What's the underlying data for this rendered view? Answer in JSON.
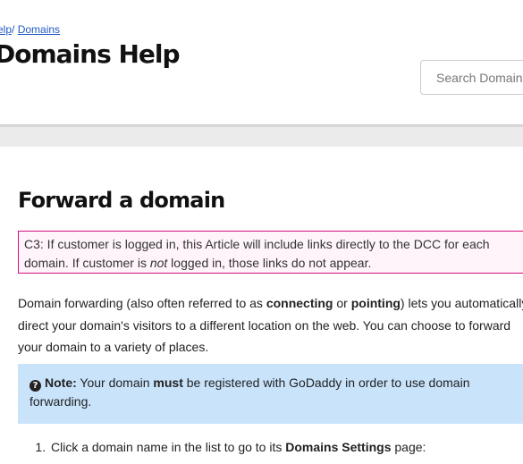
{
  "breadcrumb": {
    "parent": "elp",
    "separator": "/",
    "current": "Domains"
  },
  "header": {
    "title": "Domains Help",
    "search_placeholder": "Search Domains Help"
  },
  "article": {
    "title": "Forward a domain",
    "c3": {
      "part1": "C3: If customer is logged in, this Article will include links directly to the DCC for each domain. If customer is ",
      "emphasis": "not",
      "part2": " logged in, those links do not appear."
    },
    "intro": {
      "part1": "Domain forwarding (also often referred to as ",
      "bold1": "connecting",
      "part2": " or ",
      "bold2": "pointing",
      "part3": ") lets you automatically direct your domain's visitors to a different location on the web. You can choose to forward your domain to a variety of places."
    },
    "note": {
      "icon": "question-icon",
      "icon_glyph": "?",
      "label": "Note:",
      "part1": " Your domain ",
      "bold": "must",
      "part2": " be registered with GoDaddy in order to use domain forwarding."
    },
    "steps": [
      {
        "part1": "Click a domain name in the list to go to its ",
        "bold": "Domains Settings",
        "part2": " page:"
      }
    ]
  },
  "colors": {
    "link": "#1f58c2",
    "c3_border": "#d10d80",
    "note_background": "#c9e3fb",
    "gray_band": "#ebebeb"
  }
}
